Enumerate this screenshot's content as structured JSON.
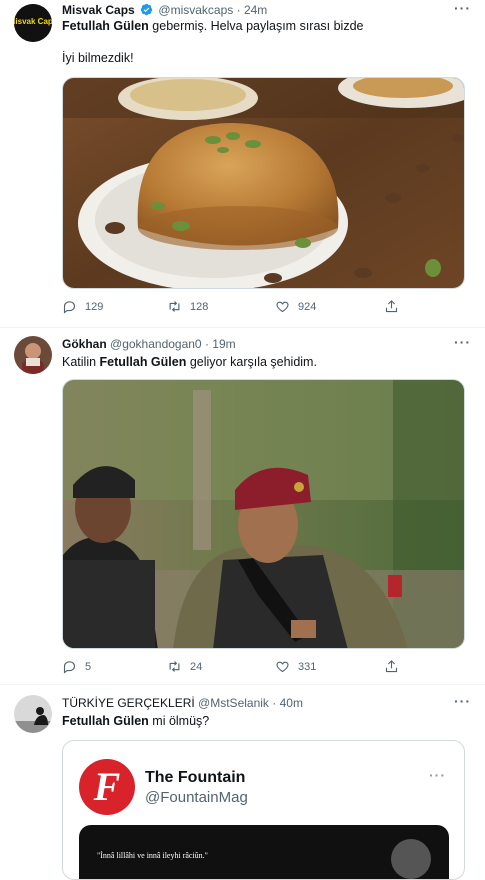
{
  "tweets": [
    {
      "name": "Misvak Caps",
      "verified": true,
      "handle": "@misvakcaps",
      "dot": "·",
      "time": "24m",
      "text_bold": "Fetullah Gülen",
      "text_rest": " gebermiş. Helva paylaşım sırası bizde",
      "text_line2": "İyi bilmezdik!",
      "replies": "129",
      "retweets": "128",
      "likes": "924",
      "avatar_label": "Misvak Caps"
    },
    {
      "name": "Gökhan",
      "handle": "@gokhandogan0",
      "dot": "·",
      "time": "19m",
      "text_pre": "Katilin ",
      "text_bold": "Fetullah Gülen",
      "text_rest": " geliyor karşıla şehidim.",
      "replies": "5",
      "retweets": "24",
      "likes": "331"
    },
    {
      "name": "TÜRKİYE GERÇEKLERİ",
      "handle": "@MstSelanik",
      "dot": "·",
      "time": "40m",
      "text_bold": "Fetullah Gülen",
      "text_rest": " mi ölmüş?",
      "quote": {
        "name": "The Fountain",
        "handle": "@FountainMag",
        "logo_letter": "F",
        "banner_text": "\"İnnâ lillâhi ve innâ ileyhi râciûn.\""
      }
    }
  ],
  "colors": {
    "verified": "#1d9bf0",
    "muted": "#536471",
    "fountain_red": "#d8232a"
  }
}
